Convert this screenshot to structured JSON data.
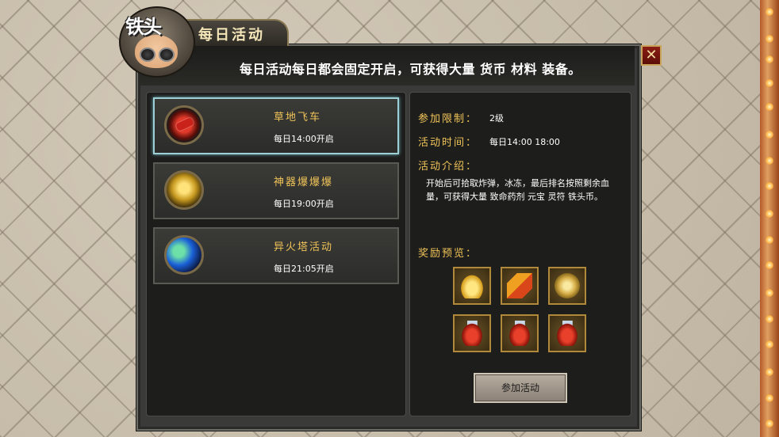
{
  "window": {
    "title": "每日活动",
    "logo_text": "铁头",
    "header_text": "每日活动每日都会固定开启，可获得大量 货币 材料 装备。",
    "close_label": "✕"
  },
  "activities": [
    {
      "name": "草地飞车",
      "time": "每日14:00开启",
      "icon": "race-car-icon",
      "selected": true
    },
    {
      "name": "神器爆爆爆",
      "time": "每日19:00开启",
      "icon": "golden-artifact-icon",
      "selected": false
    },
    {
      "name": "异火塔活动",
      "time": "每日21:05开启",
      "icon": "green-fire-orb-icon",
      "selected": false
    }
  ],
  "details": {
    "limit_label": "参加限制：",
    "limit_value": "2级",
    "time_label": "活动时间：",
    "time_value": "每日14:00 18:00",
    "intro_label": "活动介绍：",
    "intro_text": "开始后可拾取炸弹，冰冻，最后排名按照剩余血量，可获得大量 致命药剂 元宝 灵符 铁头币。",
    "rewards_label": "奖励预览：",
    "rewards": [
      "gold-ingot-icon",
      "talisman-icon",
      "coin-icon",
      "potion-icon",
      "potion-icon",
      "potion-icon"
    ],
    "join_button": "参加活动"
  },
  "colors": {
    "gold_text": "#f0c458",
    "panel_bg": "#1d1d1c",
    "selected_border": "#9fcfd6"
  }
}
